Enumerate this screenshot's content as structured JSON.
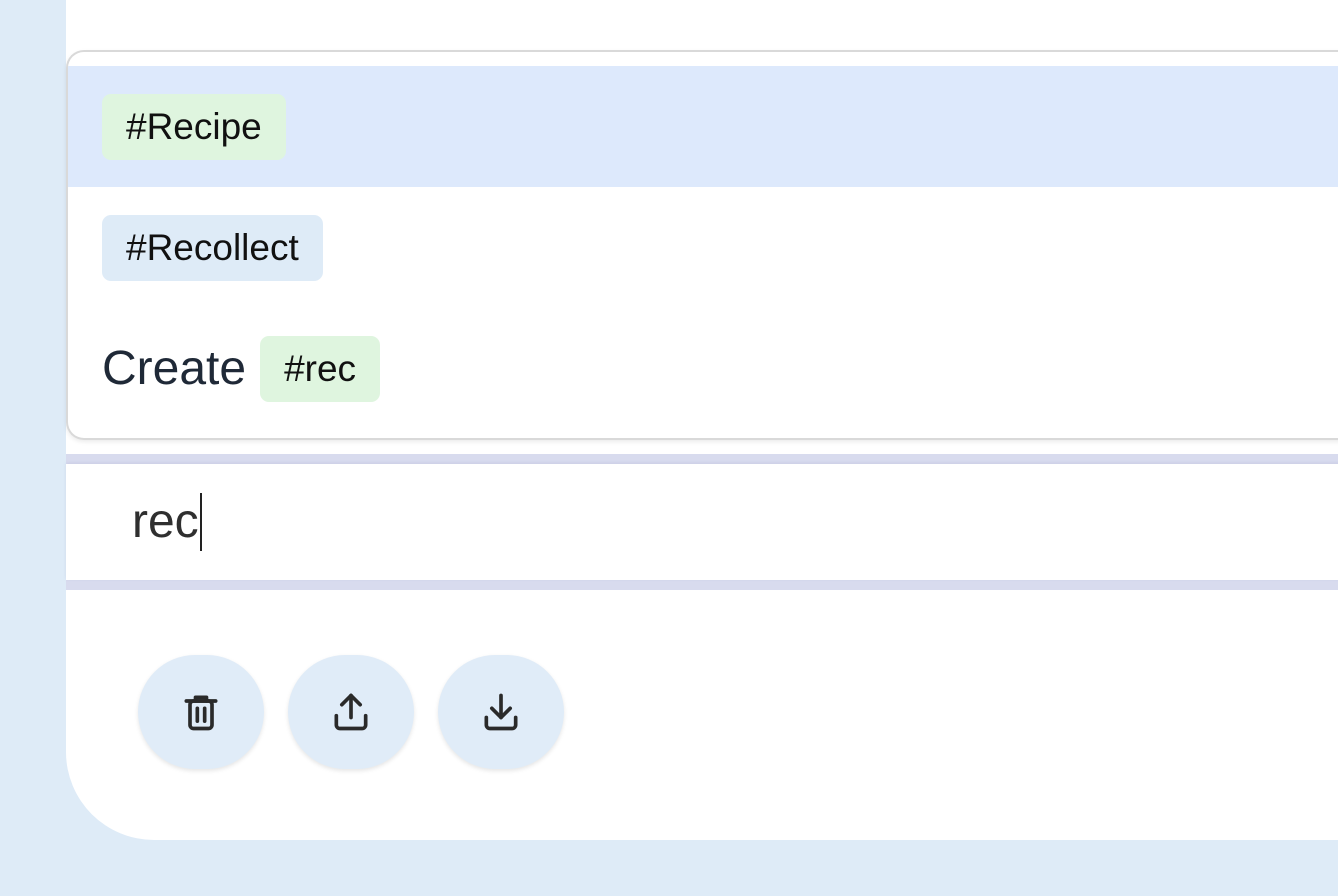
{
  "suggestions": [
    {
      "tag": "#Recipe",
      "highlighted": true
    },
    {
      "tag": "#Recollect",
      "highlighted": false
    }
  ],
  "create": {
    "label": "Create",
    "tag": "#rec"
  },
  "input": {
    "value": "rec"
  },
  "actions": {
    "delete_icon": "trash-icon",
    "share_icon": "upload-icon",
    "download_icon": "download-icon"
  },
  "colors": {
    "background": "#deebf7",
    "highlight": "#dde9fc",
    "tag_green": "#dff5df",
    "tag_blue": "#deebf7",
    "button_bg": "#e0ecf8"
  }
}
